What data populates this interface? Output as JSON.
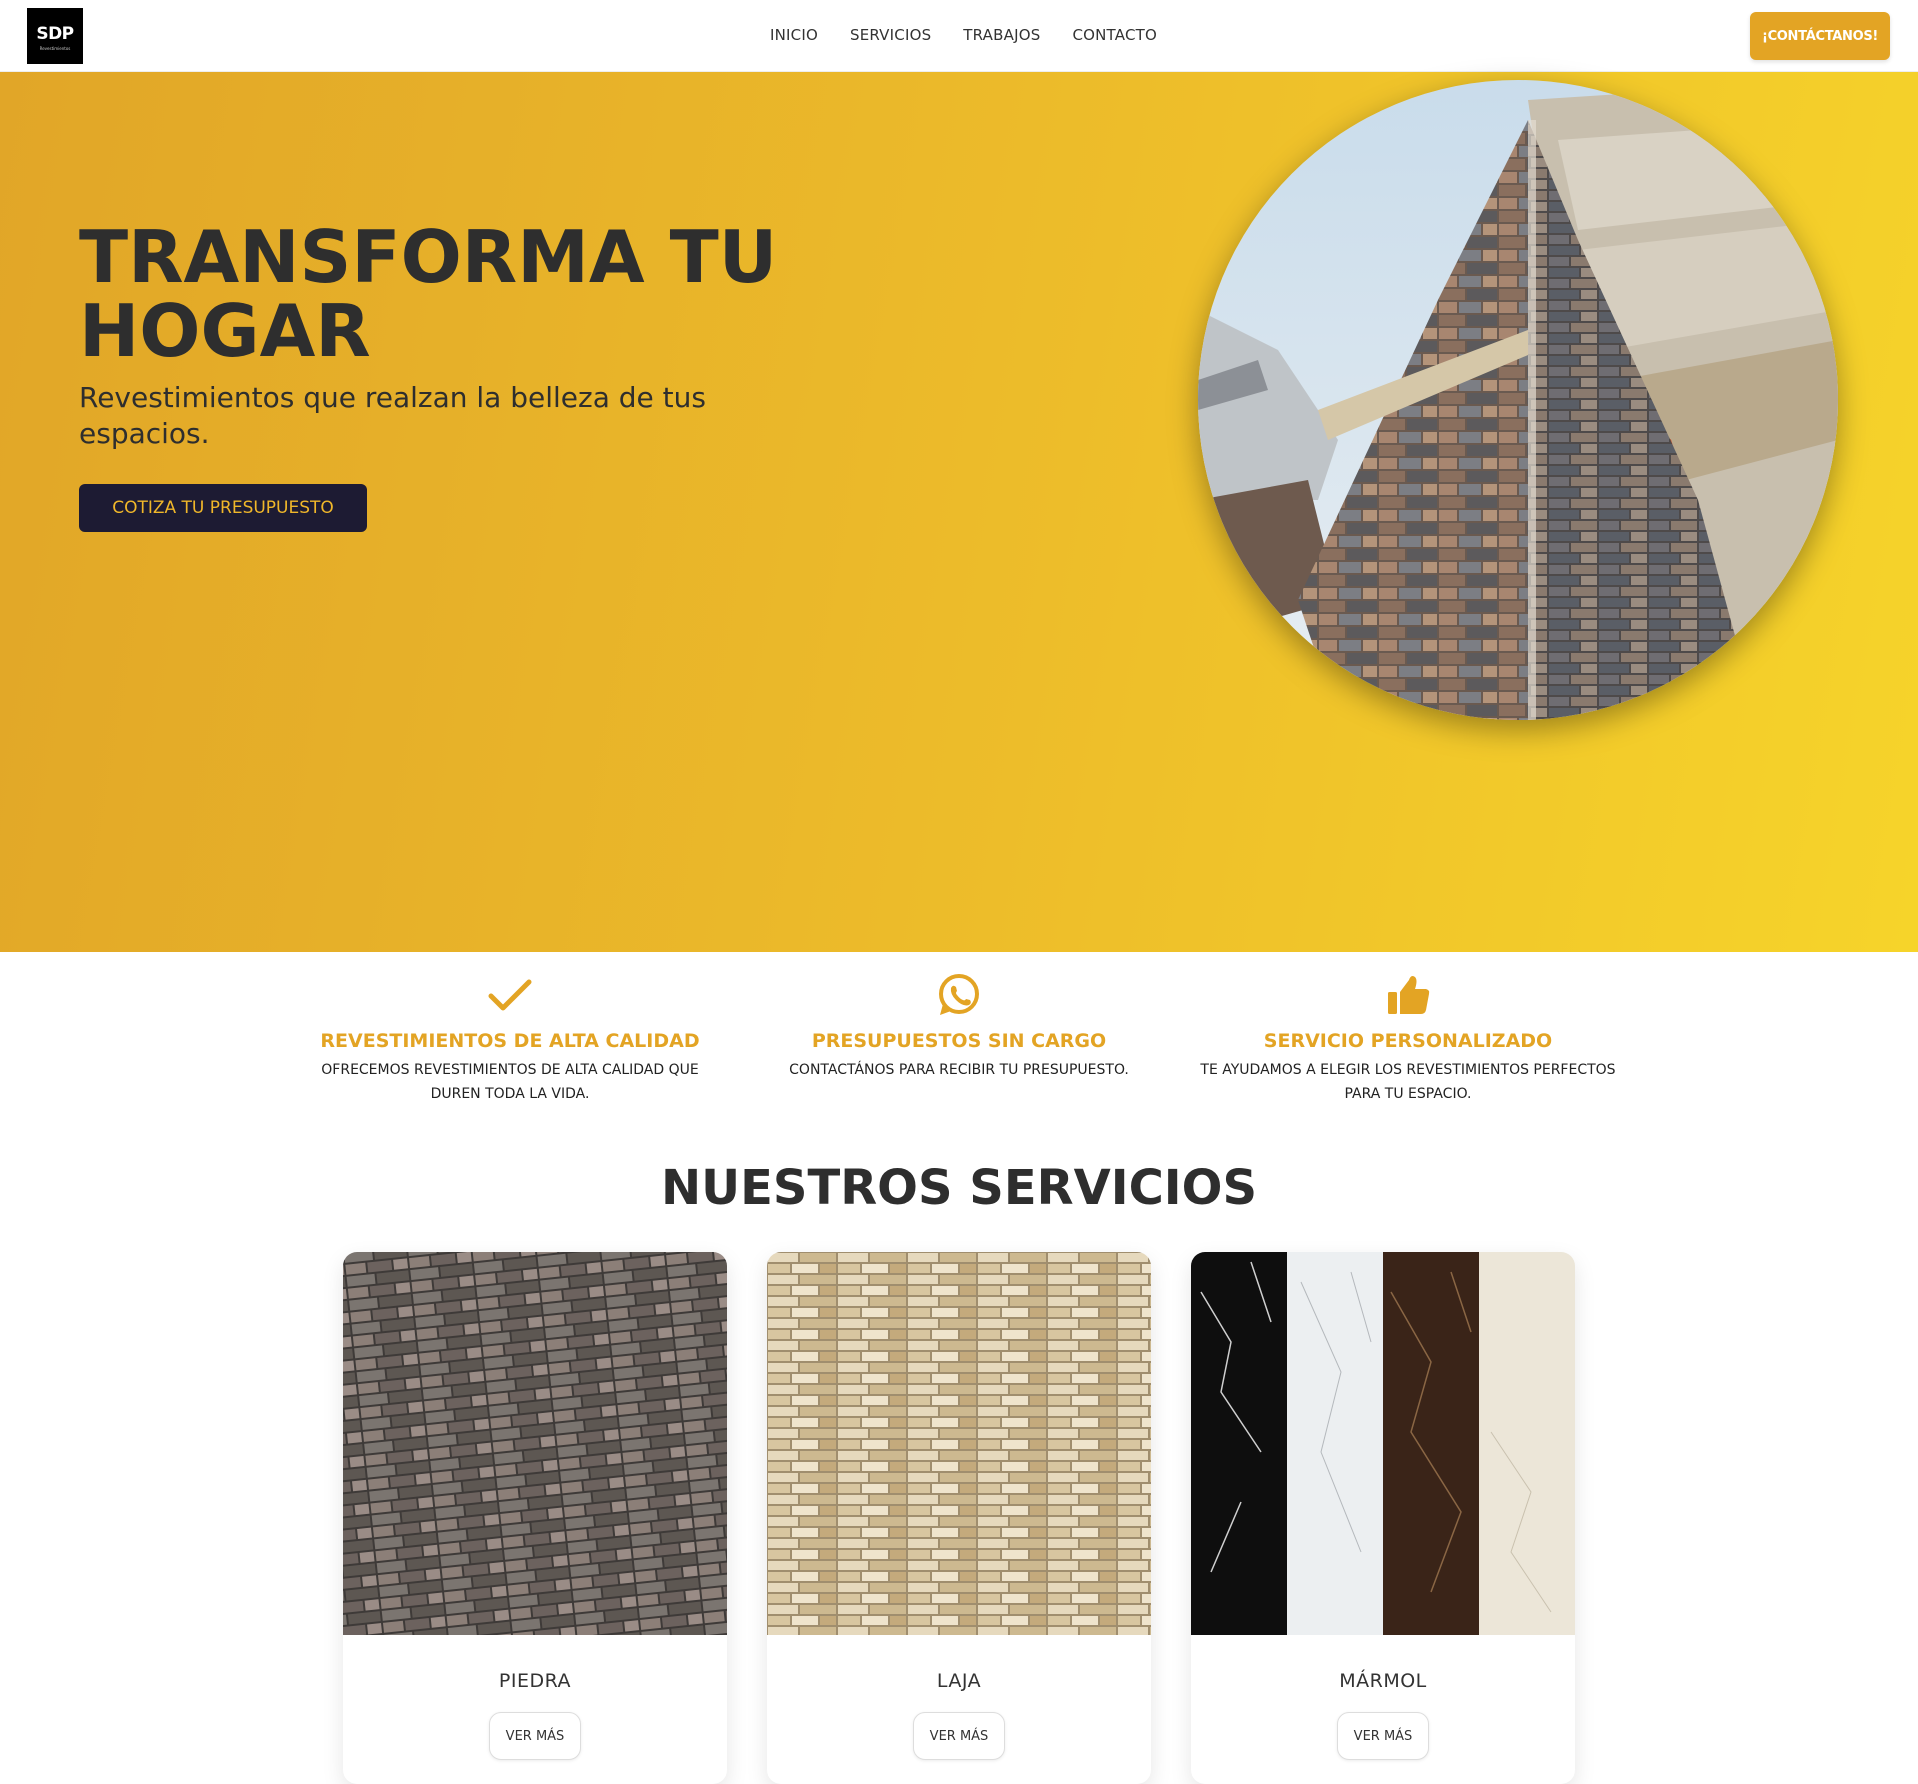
{
  "header": {
    "logo_text": "SDP",
    "logo_subtext": "Revestimientos",
    "nav": [
      "INICIO",
      "SERVICIOS",
      "TRABAJOS",
      "CONTACTO"
    ],
    "cta_label": "¡CONTÁCTANOS!"
  },
  "hero": {
    "title_line1": "TRANSFORMA TU",
    "title_line2": "HOGAR",
    "subtitle": "Revestimientos que realzan la belleza de tus espacios.",
    "button_label": "COTIZA TU PRESUPUESTO",
    "colors": {
      "gradient_start": "#e1a628",
      "gradient_end": "#f6d42a"
    }
  },
  "features": [
    {
      "icon": "check-icon",
      "title": "REVESTIMIENTOS DE ALTA CALIDAD",
      "text": "OFRECEMOS REVESTIMIENTOS DE ALTA CALIDAD QUE DUREN TODA LA VIDA."
    },
    {
      "icon": "whatsapp-icon",
      "title": "PRESUPUESTOS SIN CARGO",
      "text": "CONTACTÁNOS PARA RECIBIR TU PRESUPUESTO."
    },
    {
      "icon": "thumbs-up-icon",
      "title": "SERVICIO PERSONALIZADO",
      "text": "TE AYUDAMOS A ELEGIR LOS REVESTIMIENTOS PERFECTOS PARA TU ESPACIO."
    }
  ],
  "services": {
    "title": "NUESTROS SERVICIOS",
    "cards": [
      {
        "name": "PIEDRA",
        "button": "VER MÁS"
      },
      {
        "name": "LAJA",
        "button": "VER MÁS"
      },
      {
        "name": "MÁRMOL",
        "button": "VER MÁS"
      }
    ]
  },
  "colors": {
    "accent": "#e3a424",
    "dark": "#1d1b33",
    "text": "#2e2e2e"
  }
}
